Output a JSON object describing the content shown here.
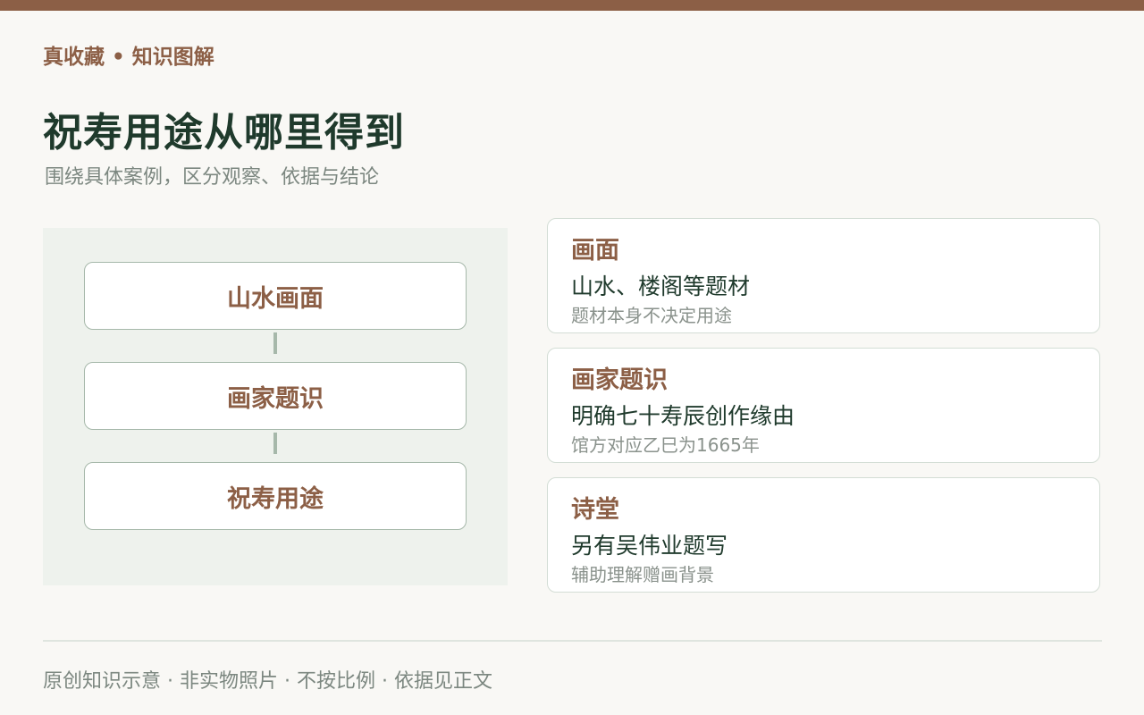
{
  "header": {
    "brand": "真收藏 • 知识图解",
    "title": "祝寿用途从哪里得到",
    "subtitle": "围绕具体案例，区分观察、依据与结论"
  },
  "flow": {
    "steps": [
      {
        "label": "山水画面"
      },
      {
        "label": "画家题识"
      },
      {
        "label": "祝寿用途"
      }
    ]
  },
  "cards": [
    {
      "title": "画面",
      "main": "山水、楼阁等题材",
      "note": "题材本身不决定用途"
    },
    {
      "title": "画家题识",
      "main": "明确七十寿辰创作缘由",
      "note": "馆方对应乙巳为1665年"
    },
    {
      "title": "诗堂",
      "main": "另有吴伟业题写",
      "note": "辅助理解赠画背景"
    }
  ],
  "footer": {
    "note": "原创知识示意 · 非实物照片 · 不按比例 · 依据见正文"
  },
  "colors": {
    "accent_brown": "#8c5f46",
    "title_green": "#1f3a2c",
    "panel_bg": "#eef2ed",
    "page_bg": "#f9f8f5"
  }
}
